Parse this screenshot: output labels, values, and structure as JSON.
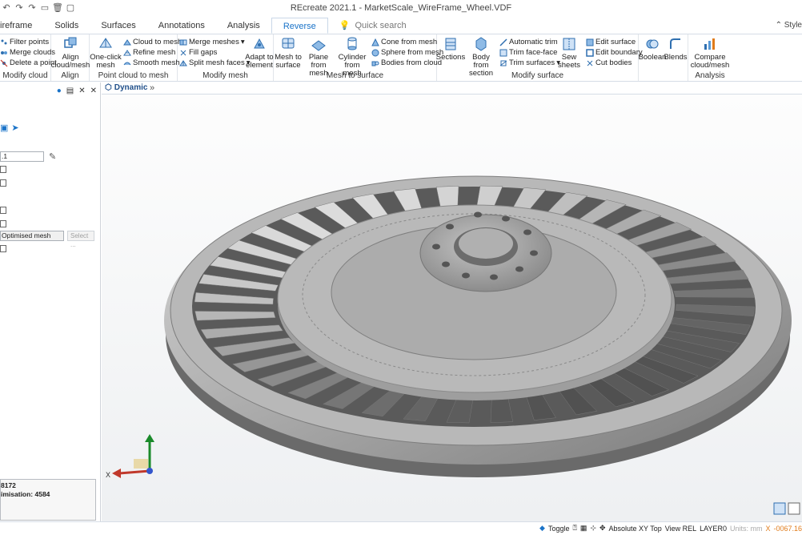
{
  "app": {
    "title": "REcreate 2021.1 - MarketScale_WireFrame_Wheel.VDF",
    "style_label": "Style"
  },
  "ribbon": {
    "tabs": [
      {
        "label": "Wireframe",
        "visible_text": "ireframe",
        "active": false
      },
      {
        "label": "Solids",
        "active": false
      },
      {
        "label": "Surfaces",
        "active": false
      },
      {
        "label": "Annotations",
        "active": false
      },
      {
        "label": "Analysis",
        "active": false
      },
      {
        "label": "Reverse",
        "active": true
      }
    ],
    "quick_search_placeholder": "Quick search",
    "groups": {
      "modify_cloud": {
        "label": "Modify cloud",
        "items": [
          "Filter points",
          "Merge clouds",
          "Delete a point"
        ]
      },
      "align": {
        "label": "Align",
        "items": [
          "Align cloud/mesh"
        ]
      },
      "point_cloud_to_mesh": {
        "label": "Point cloud to mesh",
        "big": "One-click mesh",
        "items": [
          "Cloud to mesh",
          "Refine mesh",
          "Smooth mesh"
        ]
      },
      "modify_mesh": {
        "label": "Modify mesh",
        "items": [
          "Merge meshes",
          "Fill gaps",
          "Split mesh faces"
        ],
        "big": "Adapt to element"
      },
      "mesh_to_surface": {
        "label": "Mesh to surface",
        "big": [
          "Mesh to surface",
          "Plane from mesh",
          "Cylinder from mesh"
        ],
        "items": [
          "Cone from mesh",
          "Sphere from mesh",
          "Bodies from cloud"
        ]
      },
      "modify_surface": {
        "label": "Modify surface",
        "big": [
          "Sections",
          "Body from section",
          "Sew sheets"
        ],
        "items": [
          "Automatic trim",
          "Trim face-face",
          "Trim surfaces",
          "Edit surface",
          "Edit boundary",
          "Cut bodies"
        ]
      },
      "bool": {
        "big": [
          "Boolean",
          "Blends"
        ]
      },
      "analysis": {
        "label": "Analysis",
        "big": "Compare cloud/mesh"
      }
    }
  },
  "left_panel": {
    "field_value": ".1",
    "mesh_type": "Optimised mesh",
    "select_button": "Select ...",
    "info_line1": "8172",
    "info_line2": "imisation: 4584"
  },
  "viewport": {
    "tab_label": "Dynamic",
    "axis_x": "X"
  },
  "status_bar": {
    "toggle": "Toggle",
    "coord_system": "Absolute XY Top",
    "view": "View REL",
    "layer": "LAYER0",
    "units": "Units: mm",
    "x_label": "X",
    "x_value": "-0067.16"
  },
  "colors": {
    "accent": "#1a73c8",
    "dynamic_tab": "#1f4f8a",
    "coord_orange": "#e07b1a",
    "metal_light": "#c9c9c9",
    "metal_dark": "#6f6f6f"
  }
}
